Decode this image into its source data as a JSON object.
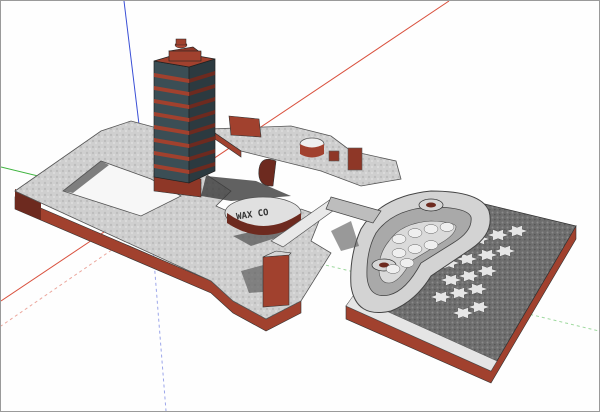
{
  "viewport": {
    "kind": "3D modeling viewport",
    "background": "#fefefe",
    "axis_colors": {
      "red": "#d9503d",
      "green": "#3fb43f",
      "blue": "#3a4fd6"
    }
  },
  "model": {
    "materials": {
      "brick": "#a1412e",
      "brick_dark": "#6d2a1f",
      "roof_light": "#d6d6d6",
      "roof_mid": "#a9a9a9",
      "roof_dark": "#5e5e5e",
      "glass": "#3b4e55",
      "court": "#777777"
    },
    "labels": {
      "sign_text": "WAX CO"
    }
  }
}
